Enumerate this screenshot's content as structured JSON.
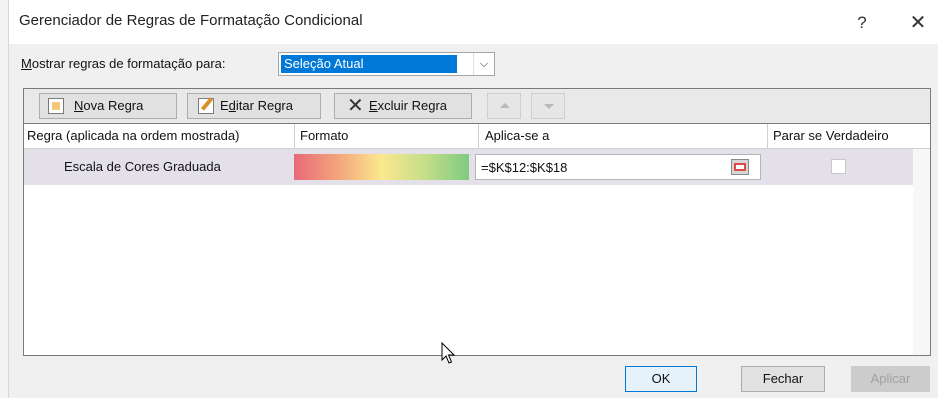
{
  "window": {
    "title": "Gerenciador de Regras de Formatação Condicional",
    "help_glyph": "?",
    "close_glyph": "✕"
  },
  "show_rules": {
    "label_accel": "M",
    "label_rest": "ostrar regras de formatação para:",
    "selected_value": "Seleção Atual",
    "arrow_glyph": "⌵"
  },
  "toolbar": {
    "new_rule": {
      "accel": "N",
      "rest": "ova Regra",
      "icon": "new-rule-icon"
    },
    "edit_rule": {
      "pre": "E",
      "accel": "d",
      "rest": "itar Regra",
      "icon": "edit-rule-icon"
    },
    "delete_rule": {
      "accel": "E",
      "rest": "xcluir Regra",
      "icon": "delete-x-icon"
    },
    "move_up_icon": "arrow-up-icon",
    "move_down_icon": "arrow-down-icon"
  },
  "grid": {
    "columns": [
      "Regra (aplicada na ordem mostrada)",
      "Formato",
      "Aplica-se a",
      "Parar se Verdadeiro"
    ],
    "rows": [
      {
        "rule": "Escala de Cores Graduada",
        "format_colors": [
          "#e8697a",
          "#f3a47c",
          "#fbe88e",
          "#c4de89",
          "#7fcb80"
        ],
        "applies_to": "=$K$12:$K$18",
        "stop_if_true": false
      }
    ]
  },
  "footer": {
    "ok": "OK",
    "close": "Fechar",
    "apply": "Aplicar"
  }
}
